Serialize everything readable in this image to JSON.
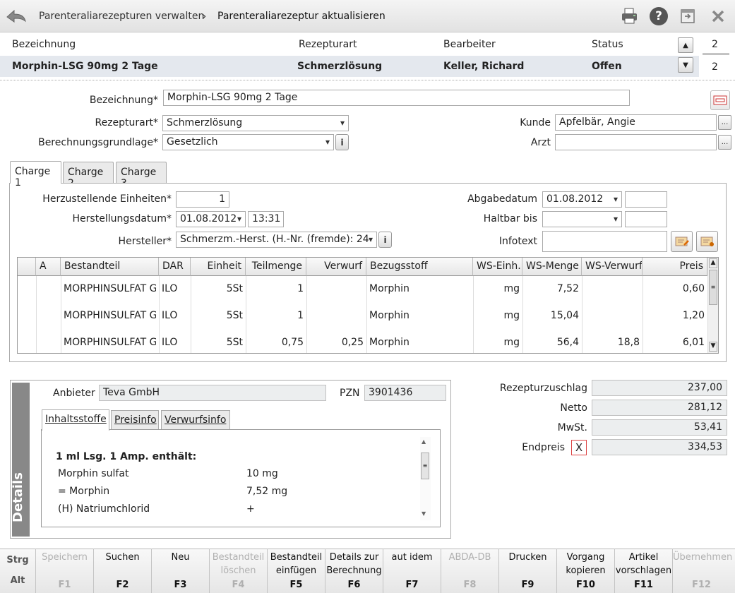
{
  "titlebar": {
    "breadcrumb_parent": "Parenteraliarezepturen verwalten",
    "separator": "›",
    "breadcrumb_current": "Parenteraliarezeptur aktualisieren"
  },
  "header": {
    "col_bezeichnung": "Bezeichnung",
    "col_rezepturart": "Rezepturart",
    "col_bearbeiter": "Bearbeiter",
    "col_status": "Status",
    "count_top": "2",
    "count_bottom": "2",
    "row": {
      "bezeichnung": "Morphin-LSG 90mg 2 Tage",
      "rezepturart": "Schmerzlösung",
      "bearbeiter": "Keller, Richard",
      "status": "Offen"
    }
  },
  "form": {
    "bezeichnung_label": "Bezeichnung*",
    "bezeichnung_value": "Morphin-LSG 90mg 2 Tage",
    "rezepturart_label": "Rezepturart*",
    "rezepturart_value": "Schmerzlösung",
    "berechnung_label": "Berechnungsgrundlage*",
    "berechnung_value": "Gesetzlich",
    "kunde_label": "Kunde",
    "kunde_value": "Apfelbär, Angie",
    "arzt_label": "Arzt",
    "arzt_value": "",
    "info_btn": "i",
    "dots": "..."
  },
  "tabs": [
    "Charge 1",
    "Charge 2",
    "Charge 3"
  ],
  "charge": {
    "einheiten_label": "Herzustellende Einheiten*",
    "einheiten_value": "1",
    "herstdatum_label": "Herstellungsdatum*",
    "herstdatum_value": "01.08.2012",
    "herstzeit_value": "13:31",
    "hersteller_label": "Hersteller*",
    "hersteller_value": "Schmerzm.-Herst. (H.-Nr. (fremde): 24",
    "abgabe_label": "Abgabedatum",
    "abgabe_value": "01.08.2012",
    "haltbar_label": "Haltbar bis",
    "haltbar_value": "",
    "infotext_label": "Infotext",
    "infotext_value": ""
  },
  "grid": {
    "headers": [
      "",
      "A",
      "Bestandteil",
      "DAR",
      "Einheit",
      "Teilmenge",
      "Verwurf",
      "Bezugsstoff",
      "WS-Einh.",
      "WS-Menge",
      "WS-Verwurf",
      "Preis"
    ],
    "rows": [
      [
        "",
        "",
        "MORPHINSULFAT GI",
        "ILO",
        "5St",
        "1",
        "",
        "Morphin",
        "mg",
        "7,52",
        "",
        "0,60"
      ],
      [
        "",
        "",
        "MORPHINSULFAT GI",
        "ILO",
        "5St",
        "1",
        "",
        "Morphin",
        "mg",
        "15,04",
        "",
        "1,20"
      ],
      [
        "",
        "",
        "MORPHINSULFAT GI",
        "ILO",
        "5St",
        "0,75",
        "0,25",
        "Morphin",
        "mg",
        "56,4",
        "18,8",
        "6,01"
      ]
    ]
  },
  "details": {
    "bar_label": "Details",
    "anbieter_label": "Anbieter",
    "anbieter_value": "Teva GmbH",
    "pzn_label": "PZN",
    "pzn_value": "3901436",
    "subtabs": [
      "Inhaltsstoffe",
      "Preisinfo",
      "Verwurfsinfo"
    ],
    "content_heading": "1 ml Lsg. 1 Amp. enthält:",
    "ingredients": [
      {
        "name": "Morphin sulfat",
        "amount": "10 mg"
      },
      {
        "name": "= Morphin",
        "amount": "7,52 mg"
      },
      {
        "name": "(H) Natriumchlorid",
        "amount": "+"
      }
    ]
  },
  "totals": {
    "zuschlag_label": "Rezepturzuschlag",
    "zuschlag_value": "237,00",
    "netto_label": "Netto",
    "netto_value": "281,12",
    "mwst_label": "MwSt.",
    "mwst_value": "53,41",
    "endpreis_label": "Endpreis",
    "endpreis_check": "X",
    "endpreis_value": "334,53"
  },
  "fkeys": {
    "strg": "Strg",
    "alt": "Alt",
    "items": [
      {
        "label": "Speichern",
        "key": "F1",
        "enabled": false
      },
      {
        "label": "Suchen",
        "key": "F2",
        "enabled": true
      },
      {
        "label": "Neu",
        "key": "F3",
        "enabled": true
      },
      {
        "label": "Bestandteil löschen",
        "key": "F4",
        "enabled": false
      },
      {
        "label": "Bestandteil einfügen",
        "key": "F5",
        "enabled": true
      },
      {
        "label": "Details zur Berechnung",
        "key": "F6",
        "enabled": true
      },
      {
        "label": "aut idem",
        "key": "F7",
        "enabled": true
      },
      {
        "label": "ABDA-DB",
        "key": "F8",
        "enabled": false
      },
      {
        "label": "Drucken",
        "key": "F9",
        "enabled": true
      },
      {
        "label": "Vorgang kopieren",
        "key": "F10",
        "enabled": true
      },
      {
        "label": "Artikel vorschlagen",
        "key": "F11",
        "enabled": true
      },
      {
        "label": "Übernehmen",
        "key": "F12",
        "enabled": false
      }
    ]
  },
  "colors": {
    "accent": "#e4e8ee",
    "help": "#555555",
    "details_bar": "#888888"
  }
}
